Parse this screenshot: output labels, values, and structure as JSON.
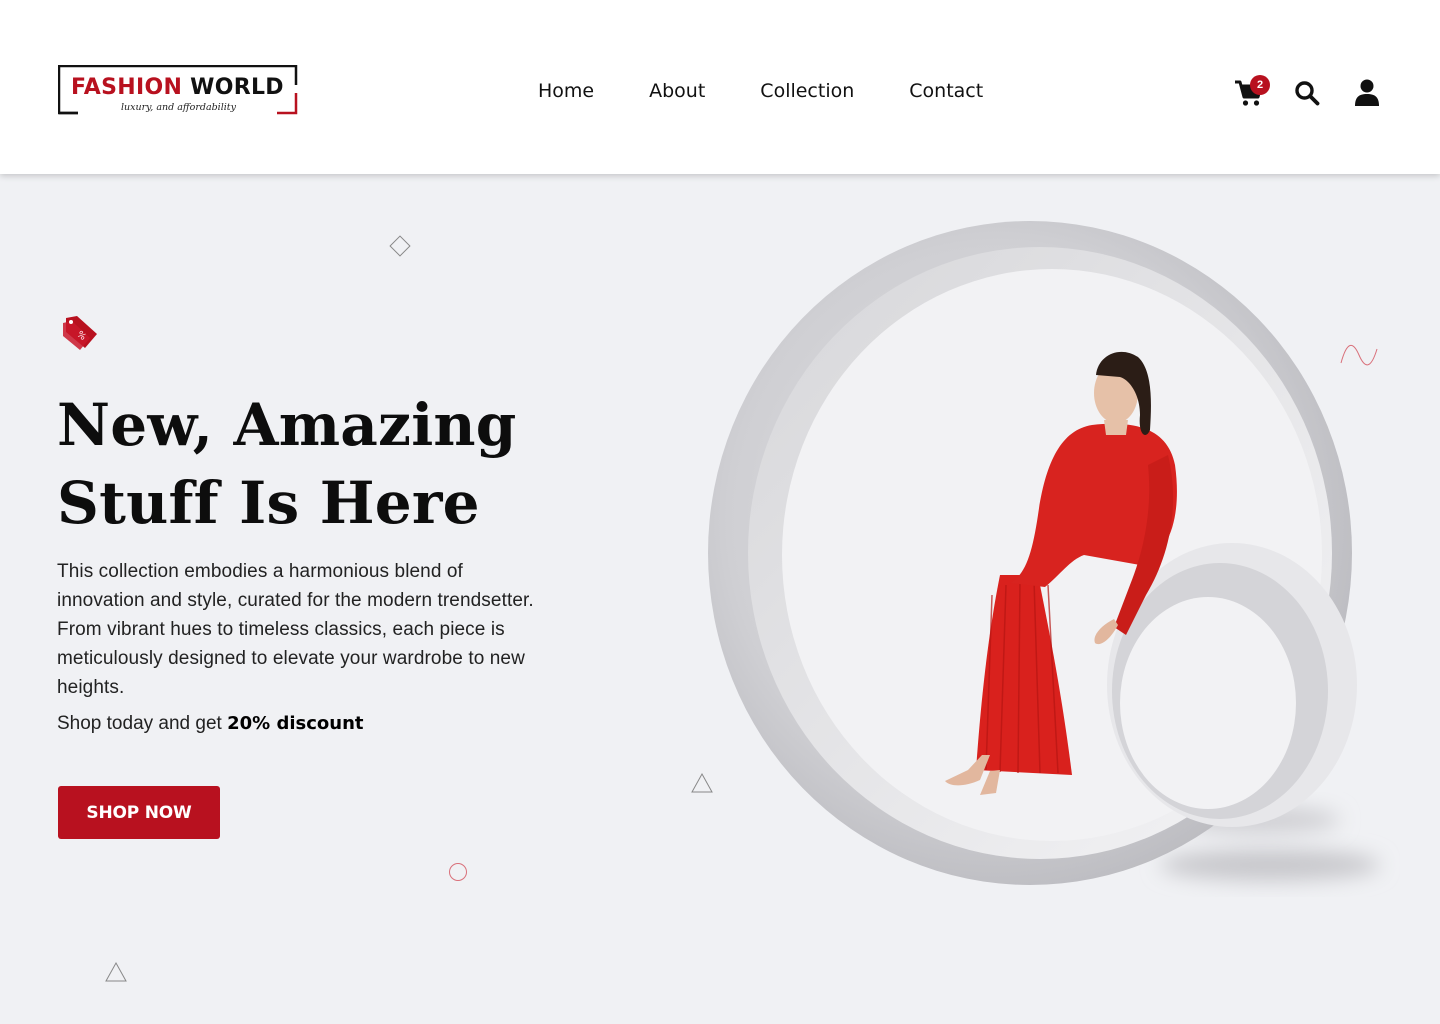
{
  "header": {
    "logo": {
      "brand_part1": "FASHION",
      "brand_part2": "WORLD",
      "tagline": "luxury, and affordability"
    },
    "nav": [
      {
        "label": "Home"
      },
      {
        "label": "About"
      },
      {
        "label": "Collection"
      },
      {
        "label": "Contact"
      }
    ],
    "icons": {
      "cart": "cart-icon",
      "cart_count": "2",
      "search": "search-icon",
      "user": "user-icon"
    }
  },
  "hero": {
    "tag_icon": "price-tag-icon",
    "headline_line1": "New, Amazing",
    "headline_line2": "Stuff Is Here",
    "description_lines": [
      "This collection embodies a harmonious blend of",
      "innovation and style, curated for the modern trendsetter.",
      "From vibrant hues to timeless classics, each piece is",
      "meticulously designed to elevate your wardrobe to new",
      "heights."
    ],
    "promo_prefix": "Shop today and get",
    "promo_discount": "20%  discount",
    "cta_label": "SHOP NOW"
  },
  "colors": {
    "accent": "#b8111f",
    "background": "#f0f1f4",
    "header_bg": "#ffffff",
    "text": "#111111"
  }
}
